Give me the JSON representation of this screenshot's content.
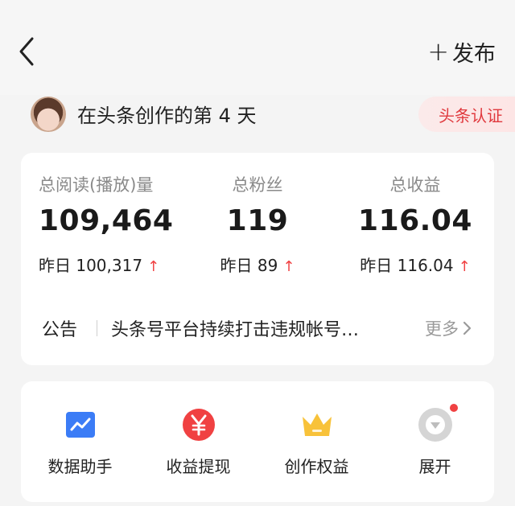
{
  "header": {
    "publish_plus": "+",
    "publish_label": "发布"
  },
  "profile": {
    "title": "在头条创作的第 4 天",
    "badge": "头条认证"
  },
  "stats": [
    {
      "label": "总阅读(播放)量",
      "value": "109,464",
      "yesterday": "昨日 100,317",
      "trend": "up"
    },
    {
      "label": "总粉丝",
      "value": "119",
      "yesterday": "昨日 89",
      "trend": "up"
    },
    {
      "label": "总收益",
      "value": "116.04",
      "yesterday": "昨日 116.04",
      "trend": "up"
    }
  ],
  "announcement": {
    "tag": "公告",
    "text": "头条号平台持续打击违规帐号…",
    "more": "更多"
  },
  "tools": [
    {
      "label": "数据助手",
      "icon": "chart-icon",
      "color": "#3b7cf6"
    },
    {
      "label": "收益提现",
      "icon": "yuan-icon",
      "color": "#f04142"
    },
    {
      "label": "创作权益",
      "icon": "crown-icon",
      "color": "#f8c23a"
    },
    {
      "label": "展开",
      "icon": "expand-icon",
      "color": "#d5d5d5",
      "notification_dot": true
    }
  ],
  "colors": {
    "accent_red": "#f04142",
    "muted_text": "#8a8a8a",
    "card_bg": "#ffffff",
    "page_bg": "#f4f4f4"
  }
}
